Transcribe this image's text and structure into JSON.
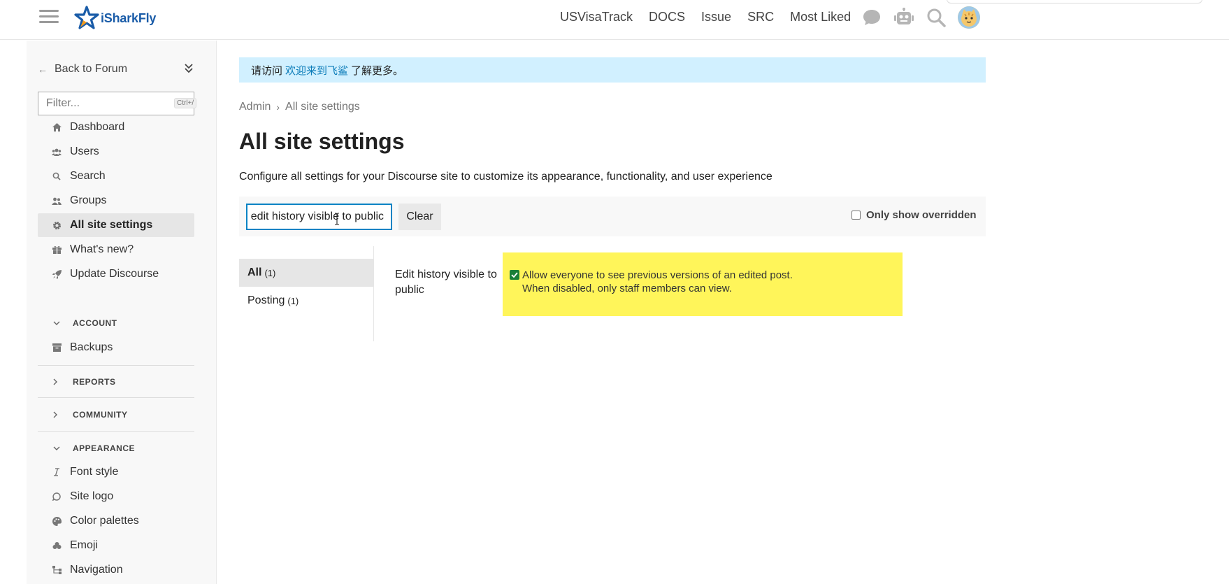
{
  "header": {
    "logo_text": "iSharkFly",
    "nav": [
      "USVisaTrack",
      "DOCS",
      "Issue",
      "SRC",
      "Most Liked"
    ],
    "icons": [
      "chat-icon",
      "robot-icon",
      "search-icon",
      "user-avatar"
    ]
  },
  "sidebar": {
    "back_label": "Back to Forum",
    "filter_placeholder": "Filter...",
    "filter_shortcut": "Ctrl+/",
    "items": [
      {
        "label": "Dashboard",
        "icon": "home-icon"
      },
      {
        "label": "Users",
        "icon": "users-icon"
      },
      {
        "label": "Search",
        "icon": "search-icon"
      },
      {
        "label": "Groups",
        "icon": "groups-icon"
      },
      {
        "label": "All site settings",
        "icon": "gear-icon",
        "active": true
      },
      {
        "label": "What's new?",
        "icon": "gift-icon"
      },
      {
        "label": "Update Discourse",
        "icon": "rocket-icon"
      }
    ],
    "sections": {
      "account": {
        "label": "ACCOUNT",
        "items": [
          {
            "label": "Backups",
            "icon": "archive-icon"
          }
        ]
      },
      "reports": {
        "label": "REPORTS"
      },
      "community": {
        "label": "COMMUNITY"
      },
      "appearance": {
        "label": "APPEARANCE",
        "items": [
          {
            "label": "Font style",
            "icon": "italic-icon"
          },
          {
            "label": "Site logo",
            "icon": "speech-icon"
          },
          {
            "label": "Color palettes",
            "icon": "palette-icon"
          },
          {
            "label": "Emoji",
            "icon": "emoji-icon"
          },
          {
            "label": "Navigation",
            "icon": "sitemap-icon"
          }
        ]
      }
    }
  },
  "notice": {
    "prefix": "请访问",
    "link": "欢迎来到飞鲨",
    "suffix": "了解更多。"
  },
  "breadcrumb": [
    "Admin",
    "All site settings"
  ],
  "page": {
    "title": "All site settings",
    "description": "Configure all settings for your Discourse site to customize its appearance, functionality, and user experience"
  },
  "filter_bar": {
    "search_value": "edit history visible to public",
    "clear_label": "Clear",
    "only_overridden_label": "Only show overridden"
  },
  "categories": [
    {
      "label": "All",
      "count": "(1)",
      "active": true
    },
    {
      "label": "Posting",
      "count": "(1)"
    }
  ],
  "setting": {
    "label": "Edit history visible to public",
    "checked": true,
    "description_line1": "Allow everyone to see previous versions of an edited post.",
    "description_line2": "When disabled, only staff members can view."
  },
  "colors": {
    "accent": "#0a83c4",
    "notice_bg": "#d1f0ff",
    "highlight": "#fff55a",
    "check": "#1a7f37"
  }
}
